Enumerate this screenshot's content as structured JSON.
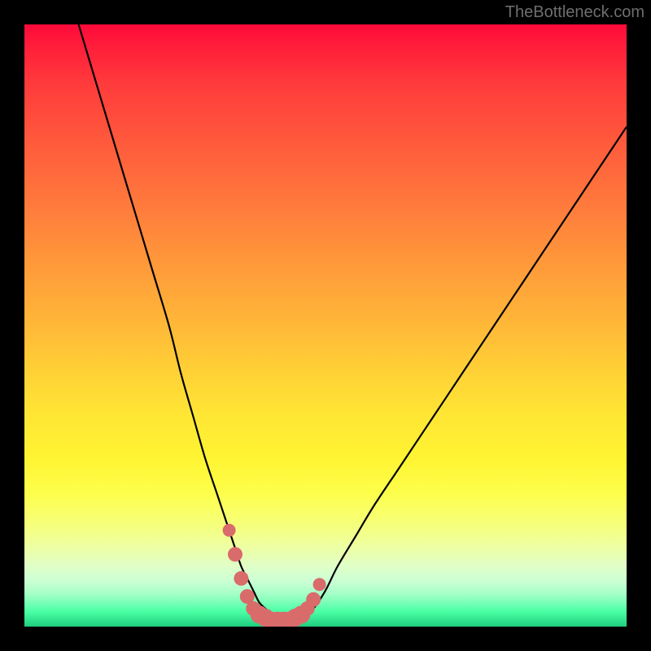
{
  "watermark": "TheBottleneck.com",
  "colors": {
    "frame": "#000000",
    "curve_stroke": "#000000",
    "marker_fill": "#d96b6b",
    "gradient_top": "#ff0a3a",
    "gradient_bottom": "#1fce80"
  },
  "chart_data": {
    "type": "line",
    "title": "",
    "xlabel": "",
    "ylabel": "",
    "xlim": [
      0,
      100
    ],
    "ylim": [
      0,
      100
    ],
    "grid": false,
    "series": [
      {
        "name": "bottleneck-curve",
        "x": [
          9,
          12,
          15,
          18,
          21,
          24,
          26,
          28,
          30,
          32,
          34,
          35,
          36,
          37,
          38,
          39,
          40,
          41,
          42,
          43,
          44,
          45,
          46,
          48,
          50,
          52,
          55,
          58,
          62,
          66,
          70,
          74,
          78,
          82,
          86,
          90,
          94,
          98,
          100
        ],
        "y": [
          100,
          90,
          80,
          70,
          60,
          50,
          42,
          35,
          28,
          22,
          16,
          13,
          10,
          8,
          6,
          4,
          3,
          2,
          1.5,
          1,
          1,
          1,
          1.5,
          3,
          6,
          10,
          15,
          20,
          26,
          32,
          38,
          44,
          50,
          56,
          62,
          68,
          74,
          80,
          83
        ]
      }
    ],
    "markers": {
      "name": "highlighted-range",
      "x": [
        34,
        35,
        36,
        37,
        38,
        39,
        40,
        41,
        42,
        43,
        44,
        45,
        46,
        47,
        48,
        49
      ],
      "y": [
        16,
        12,
        8,
        5,
        3,
        2,
        1.5,
        1,
        1,
        1,
        1,
        1.5,
        2,
        3,
        4.5,
        7
      ]
    }
  }
}
